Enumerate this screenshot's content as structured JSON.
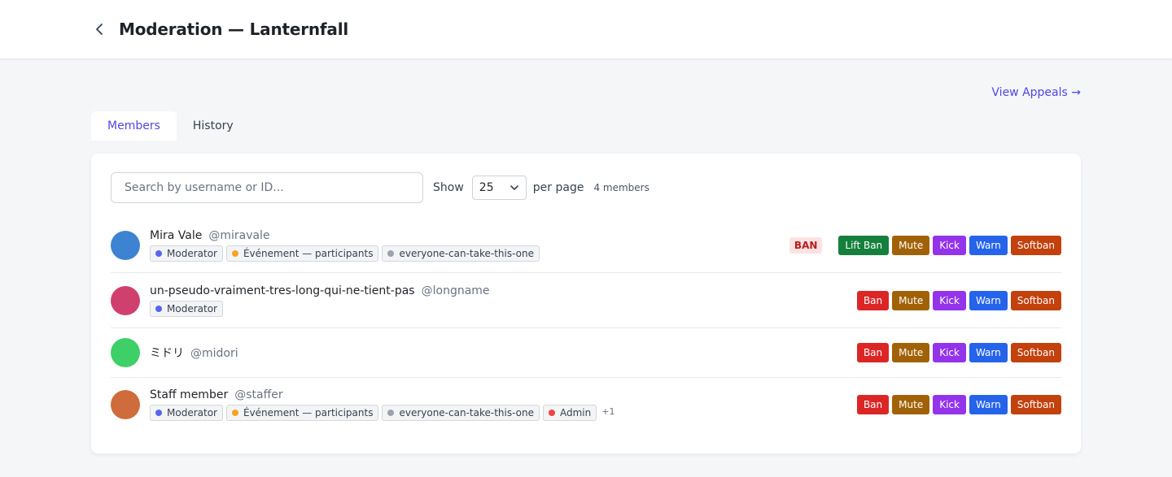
{
  "header": {
    "title": "Moderation — Lanternfall",
    "back_icon": "chevron-left-icon"
  },
  "appeals_link": "View Appeals →",
  "tabs": [
    {
      "label": "Members",
      "active": true
    },
    {
      "label": "History",
      "active": false
    }
  ],
  "search": {
    "placeholder": "Search by username or ID...",
    "value": ""
  },
  "pagination": {
    "show_label": "Show",
    "per_page_value": "25",
    "per_page_label": "per page",
    "count": "4 members"
  },
  "members": [
    {
      "name": "Mira Vale",
      "handle": "@miravale",
      "avatar_color": "#3d83d1",
      "status": "BAN",
      "roles": [
        {
          "label": "Moderator",
          "color": "#5865f2"
        },
        {
          "label": "Événement — participants",
          "color": "#f5a623"
        },
        {
          "label": "everyone-can-take-this-one",
          "color": "#9ca3af"
        }
      ],
      "actions": [
        "Lift Ban",
        "Mute",
        "Kick",
        "Warn",
        "Softban"
      ]
    },
    {
      "name": "un-pseudo-vraiment-tres-long-qui-ne-tient-pas",
      "handle": "@longname",
      "avatar_color": "#cf406f",
      "roles": [
        {
          "label": "Moderator",
          "color": "#5865f2"
        }
      ],
      "actions": [
        "Ban",
        "Mute",
        "Kick",
        "Warn",
        "Softban"
      ]
    },
    {
      "name": "ミドリ",
      "handle": "@midori",
      "avatar_color": "#3ecf68",
      "roles": [],
      "actions": [
        "Ban",
        "Mute",
        "Kick",
        "Warn",
        "Softban"
      ]
    },
    {
      "name": "Staff member",
      "handle": "@staffer",
      "avatar_color": "#cf6c3c",
      "roles": [
        {
          "label": "Moderator",
          "color": "#5865f2"
        },
        {
          "label": "Événement — participants",
          "color": "#f5a623"
        },
        {
          "label": "everyone-can-take-this-one",
          "color": "#9ca3af"
        },
        {
          "label": "Admin",
          "color": "#ef4444"
        }
      ],
      "more_roles": "+1",
      "actions": [
        "Ban",
        "Mute",
        "Kick",
        "Warn",
        "Softban"
      ]
    }
  ],
  "colors": {
    "accent": "#4f46e5",
    "ban": "#dc2626",
    "lift_ban": "#15803d",
    "mute": "#a16207",
    "kick": "#9333ea",
    "warn": "#2563eb",
    "softban": "#c2410c"
  }
}
